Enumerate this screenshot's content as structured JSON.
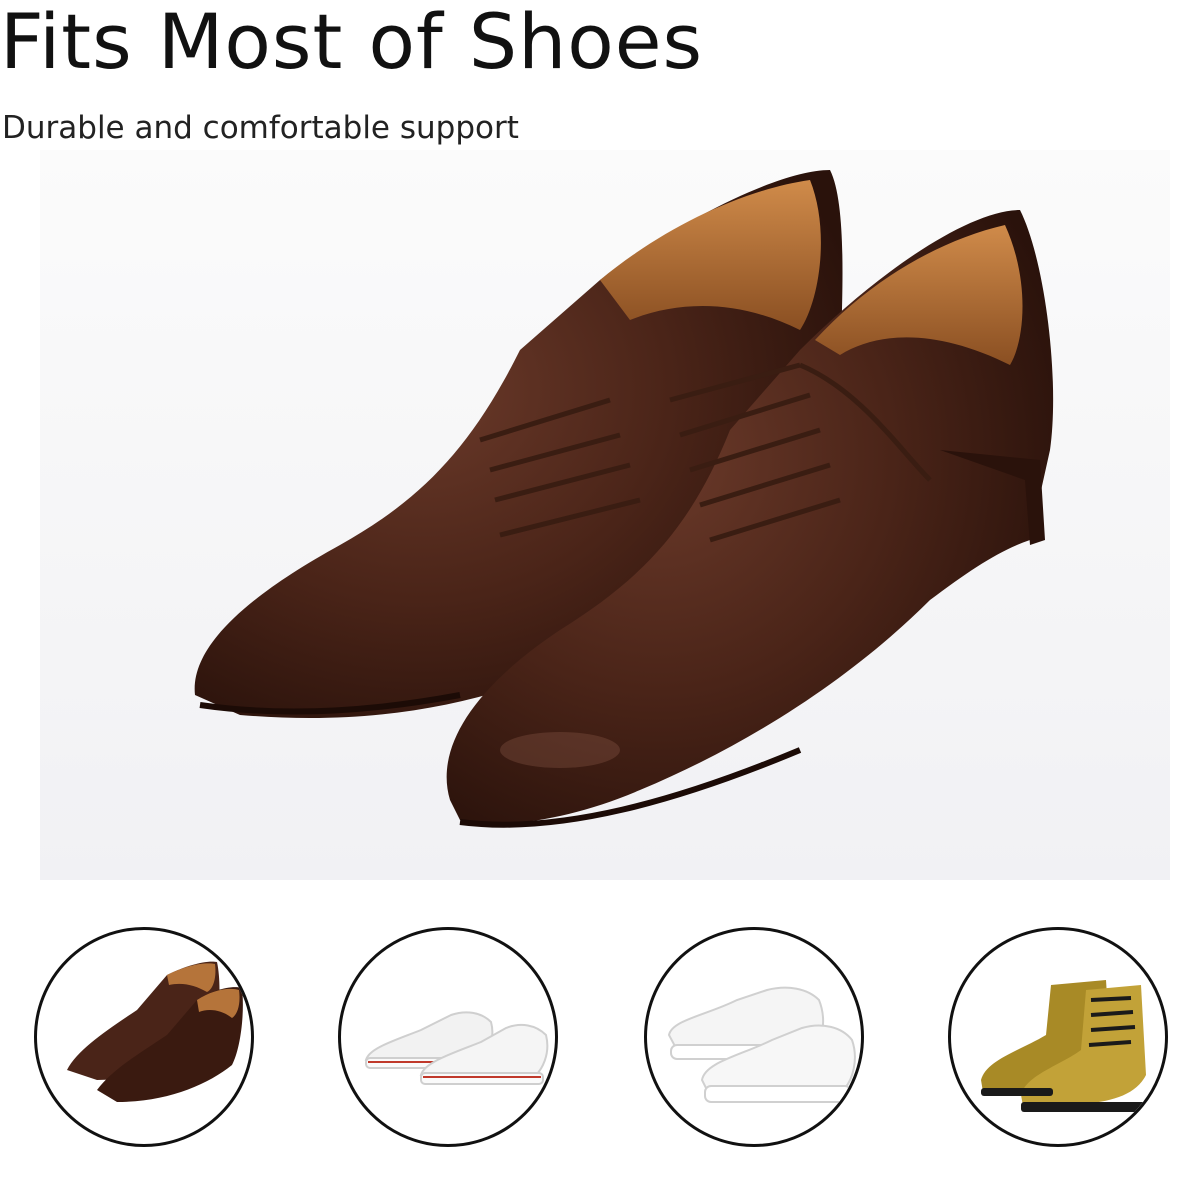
{
  "heading": {
    "title": "Fits Most of Shoes",
    "subtitle": "Durable and comfortable support"
  },
  "hero": {
    "image": "brown-leather-oxford-shoes",
    "colors": {
      "leather": "#4a2418",
      "lining": "#b5743a",
      "background": "#f4f4f6"
    }
  },
  "thumbnails": [
    {
      "image": "brown-oxford-icon",
      "color": "#4a2418"
    },
    {
      "image": "white-canvas-sneaker-icon",
      "color": "#f2f2f2"
    },
    {
      "image": "white-running-sneaker-icon",
      "color": "#f5f5f5"
    },
    {
      "image": "yellow-boot-icon",
      "color": "#b89a2e"
    }
  ],
  "colors": {
    "circle_border": "#111111",
    "text": "#111111"
  }
}
